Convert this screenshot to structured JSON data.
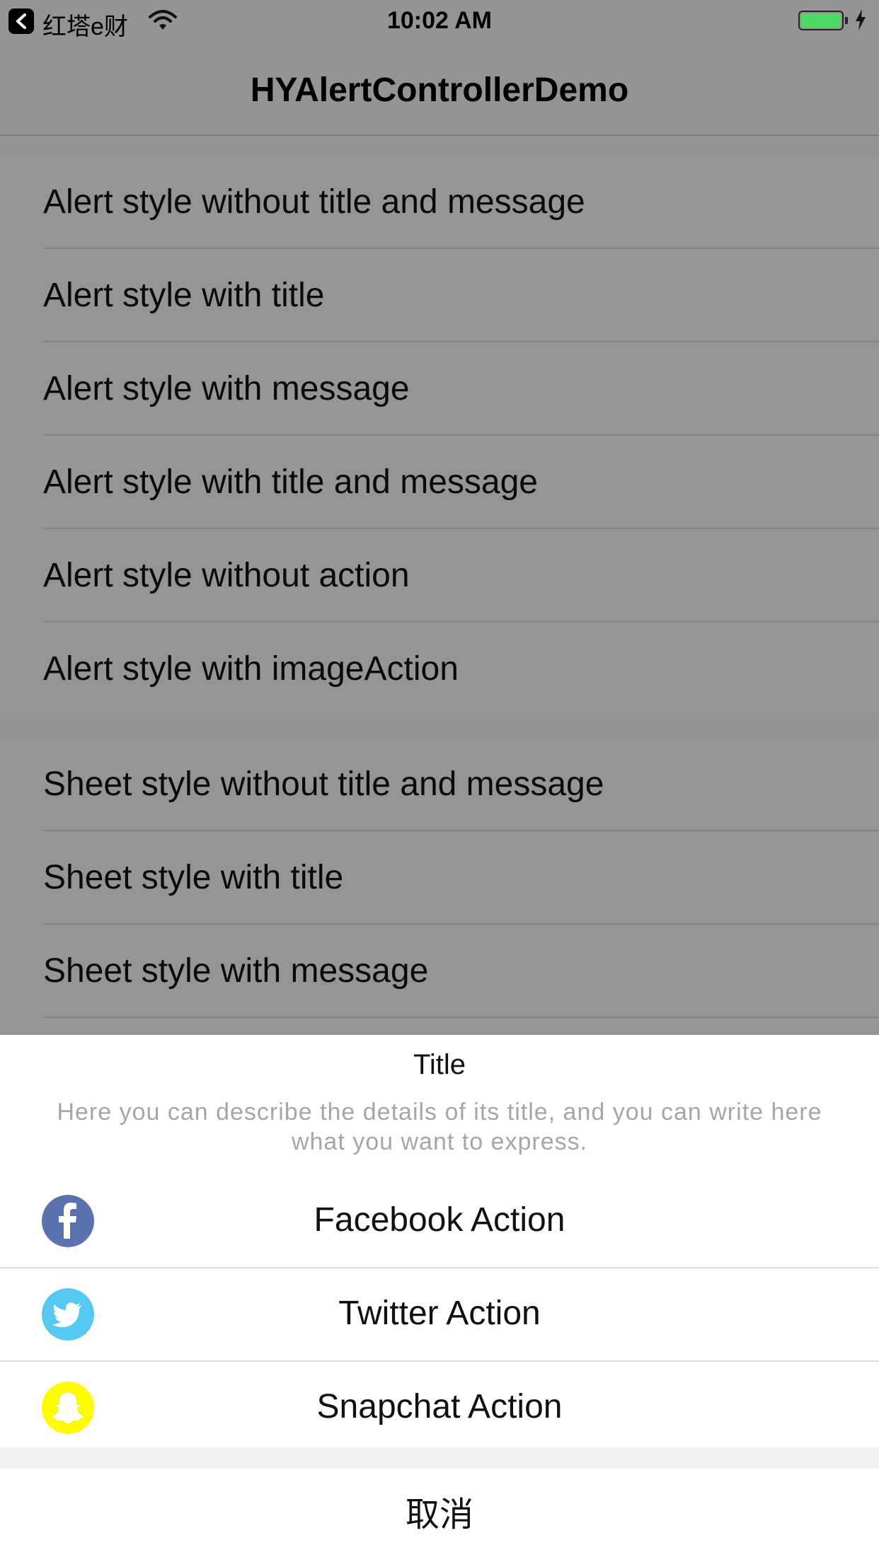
{
  "status_bar": {
    "carrier": "红塔e财",
    "time": "10:02 AM",
    "battery_color": "#4cd964",
    "icons": [
      "back-to-app-icon",
      "wifi-icon",
      "battery-icon",
      "charging-bolt-icon"
    ]
  },
  "nav": {
    "title": "HYAlertControllerDemo"
  },
  "alert_section": {
    "items": [
      {
        "label": "Alert style without title and message"
      },
      {
        "label": "Alert style with title"
      },
      {
        "label": "Alert style with message"
      },
      {
        "label": "Alert style with title and message"
      },
      {
        "label": "Alert style without action"
      },
      {
        "label": "Alert style with imageAction"
      }
    ]
  },
  "sheet_section": {
    "items": [
      {
        "label": "Sheet style without title and message"
      },
      {
        "label": "Sheet style with title"
      },
      {
        "label": "Sheet style with message"
      }
    ]
  },
  "action_sheet": {
    "title": "Title",
    "message": "Here you can describe the details of its title, and you can write here what you want to express.",
    "actions": [
      {
        "label": "Facebook Action",
        "icon": "facebook-icon",
        "color": "#5b72b1"
      },
      {
        "label": "Twitter Action",
        "icon": "twitter-icon",
        "color": "#55c9f2"
      },
      {
        "label": "Snapchat Action",
        "icon": "snapchat-icon",
        "color": "#fffc00"
      }
    ],
    "cancel_label": "取消"
  },
  "colors": {
    "dim_background": "#949494",
    "sheet_background": "#ffffff",
    "separator": "#dedede"
  }
}
